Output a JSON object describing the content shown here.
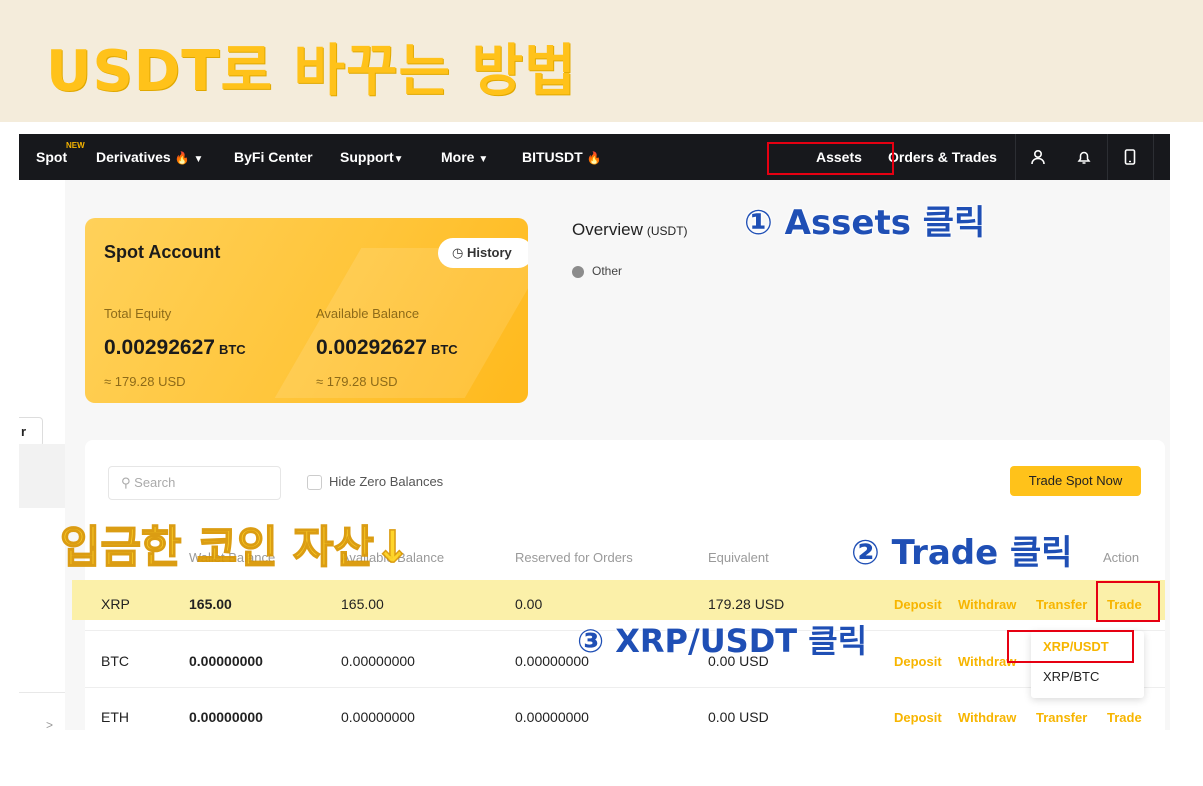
{
  "banner": {
    "title": "USDT로 바꾸는 방법"
  },
  "navbar": {
    "items": [
      {
        "label": "Spot",
        "badge": "NEW"
      },
      {
        "label": "Derivatives"
      },
      {
        "label": "ByFi Center"
      },
      {
        "label": "Support"
      },
      {
        "label": "More"
      },
      {
        "label": "BITUSDT"
      },
      {
        "label": "Assets"
      },
      {
        "label": "Orders & Trades"
      }
    ],
    "icons": [
      "user-icon",
      "bell-icon",
      "mobile-icon"
    ]
  },
  "spot_account": {
    "title": "Spot Account",
    "history_label": "History",
    "total_equity": {
      "label": "Total Equity",
      "value": "0.00292627",
      "unit": "BTC",
      "usd": "≈ 179.28 USD"
    },
    "available_balance": {
      "label": "Available Balance",
      "value": "0.00292627",
      "unit": "BTC",
      "usd": "≈ 179.28 USD"
    }
  },
  "overview": {
    "title": "Overview",
    "unit": "(USDT)",
    "legend": "Other"
  },
  "left_col": {
    "pill": "r",
    "arrow": ">"
  },
  "table": {
    "search_placeholder": "Search",
    "hide_zero": "Hide Zero Balances",
    "trade_spot_now": "Trade Spot Now",
    "headers": {
      "wallet": "Wallet Balance",
      "available": "Available Balance",
      "reserved": "Reserved for Orders",
      "equivalent": "Equivalent",
      "action": "Action"
    },
    "rows": [
      {
        "coin": "XRP",
        "wallet": "165.00",
        "available": "165.00",
        "reserved": "0.00",
        "equivalent": "179.28 USD"
      },
      {
        "coin": "BTC",
        "wallet": "0.00000000",
        "available": "0.00000000",
        "reserved": "0.00000000",
        "equivalent": "0.00 USD"
      },
      {
        "coin": "ETH",
        "wallet": "0.00000000",
        "available": "0.00000000",
        "reserved": "0.00000000",
        "equivalent": "0.00 USD"
      }
    ],
    "actions": {
      "deposit": "Deposit",
      "withdraw": "Withdraw",
      "transfer": "Transfer",
      "trade": "Trade"
    },
    "dropdown": [
      "XRP/USDT",
      "XRP/BTC"
    ]
  },
  "annotations": {
    "step1": "① Assets 클릭",
    "step2": "② Trade 클릭",
    "step3": "③ XRP/USDT 클릭",
    "deposited": "입금한 코인 자산↓"
  },
  "colors": {
    "accent": "#ffc21a",
    "action": "#f7b500",
    "navbar": "#17181c",
    "annotation_blue": "#1f4fb5",
    "highlight_box": "#e60012"
  }
}
